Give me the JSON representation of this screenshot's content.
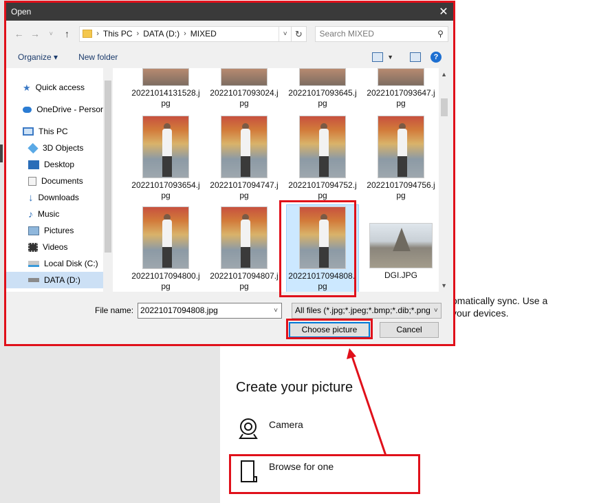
{
  "background": {
    "sync_text_line1": "omatically sync. Use a",
    "sync_text_line2": "your devices.",
    "create_title": "Create your picture",
    "options": [
      {
        "label": "Camera",
        "icon": "camera-icon"
      },
      {
        "label": "Browse for one",
        "icon": "file-icon"
      }
    ]
  },
  "dialog": {
    "title": "Open",
    "address": {
      "crumbs": [
        "This PC",
        "DATA (D:)",
        "MIXED"
      ]
    },
    "search_placeholder": "Search MIXED",
    "toolbar": {
      "organize": "Organize ▾",
      "new_folder": "New folder"
    },
    "nav_items": [
      {
        "label": "Quick access",
        "icon": "star-icon"
      },
      {
        "label": "OneDrive - Persor",
        "icon": "cloud-icon"
      },
      {
        "label": "This PC",
        "icon": "computer-icon"
      },
      {
        "label": "3D Objects",
        "icon": "cube-icon"
      },
      {
        "label": "Desktop",
        "icon": "desktop-icon"
      },
      {
        "label": "Documents",
        "icon": "document-icon"
      },
      {
        "label": "Downloads",
        "icon": "download-icon"
      },
      {
        "label": "Music",
        "icon": "music-icon"
      },
      {
        "label": "Pictures",
        "icon": "pictures-icon"
      },
      {
        "label": "Videos",
        "icon": "video-icon"
      },
      {
        "label": "Local Disk (C:)",
        "icon": "disk-icon"
      },
      {
        "label": "DATA (D:)",
        "icon": "drive-icon"
      }
    ],
    "files": [
      {
        "l1": "20221014131528.j",
        "l2": "pg"
      },
      {
        "l1": "20221017093024.j",
        "l2": "pg"
      },
      {
        "l1": "20221017093645.j",
        "l2": "pg"
      },
      {
        "l1": "20221017093647.j",
        "l2": "pg"
      },
      {
        "l1": "20221017093654.j",
        "l2": "pg"
      },
      {
        "l1": "20221017094747.j",
        "l2": "pg"
      },
      {
        "l1": "20221017094752.j",
        "l2": "pg"
      },
      {
        "l1": "20221017094756.j",
        "l2": "pg"
      },
      {
        "l1": "20221017094800.j",
        "l2": "pg"
      },
      {
        "l1": "20221017094807.j",
        "l2": "pg"
      },
      {
        "l1": "20221017094808.j",
        "l2": "pg"
      },
      {
        "l1": "DGI.JPG",
        "l2": ""
      }
    ],
    "selected_file": "20221017094808.jpg",
    "file_name_label": "File name:",
    "file_name_value": "20221017094808.jpg",
    "filter_value": "All files (*.jpg;*.jpeg;*.bmp;*.dib;*.png",
    "choose_button": "Choose picture",
    "cancel_button": "Cancel"
  },
  "colors": {
    "highlight": "#e0101a",
    "accent": "#0078d7",
    "selection": "#cce8ff"
  }
}
